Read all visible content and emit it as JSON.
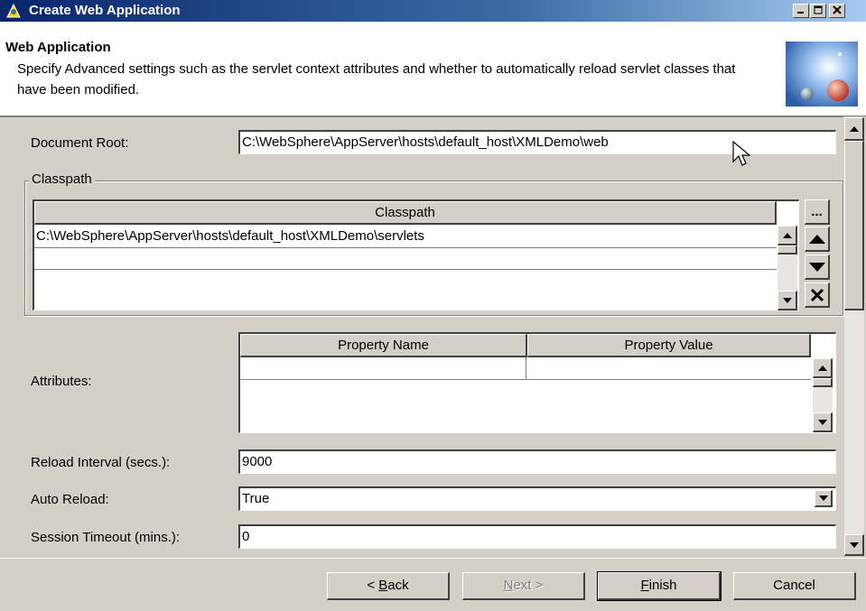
{
  "window": {
    "title": "Create Web Application"
  },
  "header": {
    "title": "Web Application",
    "description": "Specify Advanced settings such as the servlet context attributes and whether to automatically reload servlet classes that have been modified."
  },
  "form": {
    "document_root_label": "Document Root:",
    "document_root_value": "C:\\WebSphere\\AppServer\\hosts\\default_host\\XMLDemo\\web",
    "classpath_group_label": "Classpath",
    "classpath_table": {
      "column_header": "Classpath",
      "rows": [
        "C:\\WebSphere\\AppServer\\hosts\\default_host\\XMLDemo\\servlets"
      ]
    },
    "classpath_buttons": {
      "browse": "...",
      "up": "▲",
      "down": "▼",
      "remove": "✕"
    },
    "attributes_label": "Attributes:",
    "attributes_table": {
      "columns": [
        "Property Name",
        "Property Value"
      ]
    },
    "reload_interval_label": "Reload Interval (secs.):",
    "reload_interval_value": "9000",
    "auto_reload_label": "Auto Reload:",
    "auto_reload_value": "True",
    "session_timeout_label": "Session Timeout (mins.):",
    "session_timeout_value": "0"
  },
  "buttons": {
    "back_pre": "< ",
    "back_u": "B",
    "back_post": "ack",
    "next_u": "N",
    "next_post": "ext >",
    "finish_u": "F",
    "finish_post": "inish",
    "cancel": "Cancel"
  },
  "icons": {
    "app": "wizard-icon",
    "header": "globe-banner-icon",
    "minimize": "minimize-icon",
    "maximize": "maximize-icon",
    "close": "close-icon"
  }
}
